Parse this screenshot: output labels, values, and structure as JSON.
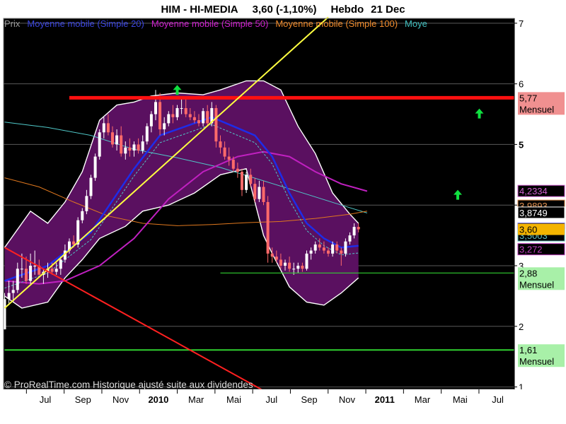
{
  "header": {
    "ticker": "HIM - HI-MEDIA",
    "quote": "3,60 (-1,10%)",
    "period": "Hebdo",
    "date": "21 Dec"
  },
  "legend": [
    {
      "label": "Prix",
      "color": "#9a9a9a"
    },
    {
      "label": "Moyenne mobile (Simple 20)",
      "color": "#3a45e0"
    },
    {
      "label": "Moyenne mobile (Simple 50)",
      "color": "#d020d0"
    },
    {
      "label": "Moyenne mobile (Simple 100)",
      "color": "#f08a2a"
    },
    {
      "label": "Moye",
      "color": "#3fc0c0"
    }
  ],
  "copyright": "© ProRealTime.com Historique ajusté suite aux dividendes",
  "colors": {
    "background": "#000000",
    "candle_up": "#ffffff",
    "candle_down": "#ff6a6a",
    "bollinger_fill": "#5a1060",
    "bollinger_line": "#ffffff",
    "sma20": "#1e2ce8",
    "sma50": "#c020c0",
    "sma100": "#e0781e",
    "sma200": "#50c8c8",
    "resistance": "#ff1010",
    "support": "#30d030",
    "trend_up": "#ffff40",
    "trend_down": "#ff2020",
    "arrow": "#10e040"
  },
  "chart_data": {
    "type": "candlestick",
    "y_axis": {
      "ylim": [
        0.96,
        7.08
      ],
      "ticks": [
        "1",
        "2",
        "3",
        "4",
        "5",
        "6",
        "7"
      ],
      "bold_ticks": [
        "5"
      ]
    },
    "x_axis": {
      "ticks": [
        "Jul",
        "Sep",
        "Nov",
        "2010",
        "Mar",
        "Mai",
        "Jul",
        "Sep",
        "Nov",
        "2011",
        "Mar",
        "Mai",
        "Jul"
      ],
      "bold_ticks": [
        "2010",
        "2011"
      ]
    },
    "ohlc": [
      [
        1.95,
        2.55,
        1.95,
        2.45
      ],
      [
        2.45,
        2.75,
        2.35,
        2.55
      ],
      [
        2.55,
        2.75,
        2.4,
        2.6
      ],
      [
        2.6,
        3.05,
        2.55,
        2.95
      ],
      [
        2.95,
        3.2,
        2.8,
        2.95
      ],
      [
        2.95,
        3.15,
        2.7,
        2.75
      ],
      [
        2.75,
        3.2,
        2.7,
        3.0
      ],
      [
        3.0,
        3.25,
        2.85,
        3.0
      ],
      [
        3.0,
        3.1,
        2.85,
        2.85
      ],
      [
        2.85,
        2.95,
        2.7,
        2.9
      ],
      [
        2.9,
        3.05,
        2.8,
        2.95
      ],
      [
        2.95,
        3.05,
        2.85,
        2.9
      ],
      [
        2.9,
        3.05,
        2.85,
        2.95
      ],
      [
        2.95,
        3.15,
        2.85,
        3.1
      ],
      [
        3.1,
        3.35,
        3.05,
        3.25
      ],
      [
        3.25,
        3.45,
        3.2,
        3.4
      ],
      [
        3.4,
        3.5,
        3.3,
        3.35
      ],
      [
        3.35,
        3.8,
        3.3,
        3.75
      ],
      [
        3.75,
        3.95,
        3.7,
        3.9
      ],
      [
        3.9,
        4.25,
        3.85,
        4.15
      ],
      [
        4.15,
        4.5,
        4.1,
        4.45
      ],
      [
        4.45,
        4.85,
        4.4,
        4.8
      ],
      [
        4.8,
        5.25,
        4.75,
        5.2
      ],
      [
        5.2,
        5.45,
        5.1,
        5.35
      ],
      [
        5.35,
        5.5,
        5.15,
        5.2
      ],
      [
        5.2,
        5.3,
        4.95,
        5.0
      ],
      [
        5.0,
        5.25,
        4.9,
        5.15
      ],
      [
        5.15,
        5.3,
        4.8,
        4.85
      ],
      [
        4.85,
        5.05,
        4.75,
        4.95
      ],
      [
        4.95,
        5.1,
        4.8,
        4.9
      ],
      [
        4.9,
        5.05,
        4.8,
        5.0
      ],
      [
        5.0,
        5.1,
        4.85,
        4.9
      ],
      [
        4.9,
        5.15,
        4.85,
        5.05
      ],
      [
        5.05,
        5.35,
        5.0,
        5.3
      ],
      [
        5.3,
        5.55,
        5.2,
        5.5
      ],
      [
        5.5,
        5.9,
        5.4,
        5.7
      ],
      [
        5.7,
        5.85,
        5.15,
        5.25
      ],
      [
        5.25,
        5.45,
        5.15,
        5.35
      ],
      [
        5.35,
        5.55,
        5.3,
        5.5
      ],
      [
        5.5,
        5.65,
        5.35,
        5.45
      ],
      [
        5.45,
        5.65,
        5.4,
        5.6
      ],
      [
        5.6,
        5.75,
        5.5,
        5.6
      ],
      [
        5.6,
        5.75,
        5.45,
        5.5
      ],
      [
        5.5,
        5.6,
        5.4,
        5.45
      ],
      [
        5.45,
        5.55,
        5.35,
        5.4
      ],
      [
        5.4,
        5.5,
        5.3,
        5.35
      ],
      [
        5.35,
        5.6,
        5.3,
        5.55
      ],
      [
        5.55,
        5.65,
        5.3,
        5.35
      ],
      [
        5.35,
        5.7,
        5.3,
        5.6
      ],
      [
        5.6,
        5.65,
        4.95,
        5.05
      ],
      [
        5.05,
        5.15,
        4.85,
        4.95
      ],
      [
        4.95,
        5.05,
        4.75,
        4.8
      ],
      [
        4.8,
        4.95,
        4.65,
        4.75
      ],
      [
        4.75,
        4.8,
        4.55,
        4.6
      ],
      [
        4.6,
        4.7,
        4.45,
        4.55
      ],
      [
        4.55,
        4.6,
        4.15,
        4.25
      ],
      [
        4.25,
        4.55,
        4.2,
        4.5
      ],
      [
        4.5,
        4.6,
        4.3,
        4.35
      ],
      [
        4.35,
        4.45,
        4.05,
        4.1
      ],
      [
        4.1,
        4.4,
        4.05,
        4.3
      ],
      [
        4.3,
        4.4,
        4.0,
        4.05
      ],
      [
        4.05,
        4.15,
        3.05,
        3.2
      ],
      [
        3.2,
        3.3,
        3.05,
        3.15
      ],
      [
        3.15,
        3.25,
        3.05,
        3.1
      ],
      [
        3.1,
        3.2,
        2.95,
        3.0
      ],
      [
        3.0,
        3.1,
        2.92,
        3.05
      ],
      [
        3.05,
        3.15,
        2.9,
        2.95
      ],
      [
        2.95,
        3.05,
        2.85,
        2.95
      ],
      [
        2.95,
        3.05,
        2.88,
        3.0
      ],
      [
        3.0,
        3.05,
        2.9,
        2.95
      ],
      [
        2.95,
        3.25,
        2.92,
        3.2
      ],
      [
        3.2,
        3.3,
        3.1,
        3.25
      ],
      [
        3.25,
        3.4,
        3.2,
        3.35
      ],
      [
        3.35,
        3.45,
        3.25,
        3.3
      ],
      [
        3.3,
        3.4,
        3.2,
        3.25
      ],
      [
        3.25,
        3.3,
        3.15,
        3.2
      ],
      [
        3.2,
        3.4,
        3.15,
        3.35
      ],
      [
        3.35,
        3.4,
        3.2,
        3.25
      ],
      [
        3.25,
        3.3,
        3.0,
        3.2
      ],
      [
        3.2,
        3.45,
        3.15,
        3.4
      ],
      [
        3.4,
        3.55,
        3.35,
        3.5
      ],
      [
        3.5,
        3.7,
        3.45,
        3.64
      ],
      [
        3.64,
        3.7,
        3.55,
        3.6
      ]
    ],
    "sma20": [
      [
        0,
        2.75
      ],
      [
        10,
        3.0
      ],
      [
        20,
        3.55
      ],
      [
        30,
        4.6
      ],
      [
        36,
        5.15
      ],
      [
        42,
        5.3
      ],
      [
        48,
        5.45
      ],
      [
        53,
        5.3
      ],
      [
        58,
        5.15
      ],
      [
        62,
        4.8
      ],
      [
        66,
        4.2
      ],
      [
        70,
        3.7
      ],
      [
        74,
        3.45
      ],
      [
        78,
        3.3
      ],
      [
        82,
        3.33
      ]
    ],
    "sma50": [
      [
        0,
        2.75
      ],
      [
        8,
        2.7
      ],
      [
        14,
        2.75
      ],
      [
        22,
        3.0
      ],
      [
        30,
        3.45
      ],
      [
        38,
        4.1
      ],
      [
        46,
        4.55
      ],
      [
        54,
        4.8
      ],
      [
        60,
        4.88
      ],
      [
        66,
        4.8
      ],
      [
        72,
        4.55
      ],
      [
        78,
        4.35
      ],
      [
        84,
        4.23
      ]
    ],
    "sma100": [
      [
        0,
        4.45
      ],
      [
        8,
        4.3
      ],
      [
        16,
        4.05
      ],
      [
        24,
        3.82
      ],
      [
        32,
        3.7
      ],
      [
        40,
        3.66
      ],
      [
        48,
        3.68
      ],
      [
        56,
        3.71
      ],
      [
        64,
        3.73
      ],
      [
        72,
        3.78
      ],
      [
        80,
        3.85
      ],
      [
        84,
        3.9
      ]
    ],
    "sma200": [
      [
        0,
        5.37
      ],
      [
        10,
        5.28
      ],
      [
        20,
        5.15
      ],
      [
        30,
        4.92
      ],
      [
        40,
        4.78
      ],
      [
        50,
        4.62
      ],
      [
        60,
        4.4
      ],
      [
        70,
        4.18
      ],
      [
        78,
        4.0
      ],
      [
        84,
        3.87
      ]
    ],
    "boll_upper": [
      [
        0,
        3.3
      ],
      [
        6,
        3.9
      ],
      [
        10,
        3.7
      ],
      [
        14,
        4.05
      ],
      [
        18,
        4.55
      ],
      [
        22,
        5.4
      ],
      [
        26,
        5.65
      ],
      [
        30,
        5.7
      ],
      [
        34,
        5.8
      ],
      [
        40,
        5.85
      ],
      [
        46,
        5.82
      ],
      [
        50,
        5.9
      ],
      [
        56,
        6.05
      ],
      [
        60,
        6.05
      ],
      [
        64,
        5.9
      ],
      [
        68,
        5.3
      ],
      [
        72,
        4.85
      ],
      [
        76,
        4.2
      ],
      [
        80,
        3.85
      ],
      [
        82,
        3.7
      ]
    ],
    "boll_lower": [
      [
        0,
        2.5
      ],
      [
        4,
        2.3
      ],
      [
        10,
        2.4
      ],
      [
        14,
        2.8
      ],
      [
        18,
        3.1
      ],
      [
        22,
        3.45
      ],
      [
        28,
        3.65
      ],
      [
        32,
        3.9
      ],
      [
        38,
        4.0
      ],
      [
        44,
        4.2
      ],
      [
        50,
        4.5
      ],
      [
        56,
        4.6
      ],
      [
        60,
        3.5
      ],
      [
        62,
        3.2
      ],
      [
        66,
        2.65
      ],
      [
        70,
        2.4
      ],
      [
        74,
        2.35
      ],
      [
        78,
        2.55
      ],
      [
        82,
        2.8
      ]
    ],
    "resistance": {
      "value": 5.77,
      "x_start": 15,
      "label": "Mensuel"
    },
    "supports": [
      {
        "value": 2.88,
        "x_start": 50,
        "label": "Mensuel"
      },
      {
        "value": 1.61,
        "x_start": 0,
        "label": "Mensuel"
      }
    ],
    "trend_up": {
      "from": [
        0,
        2.3
      ],
      "to": [
        75,
        7.1
      ]
    },
    "trend_down": {
      "from": [
        0,
        3.3
      ],
      "to": [
        61,
        0.9
      ]
    },
    "arrows": [
      [
        40,
        5.9
      ],
      [
        110,
        5.51
      ],
      [
        105,
        4.17
      ]
    ],
    "axis_tags": [
      {
        "value": 5.77,
        "text": "5,77",
        "bg": "#f09090",
        "fg": "#000000",
        "sub": "Mensuel"
      },
      {
        "value": 4.2334,
        "text": "4,2334",
        "bg": "#000000",
        "fg": "#d060d0",
        "border": "#d060d0"
      },
      {
        "value": 3.9893,
        "text": "3,9893",
        "bg": "#000000",
        "fg": "#e09050",
        "border": "#e09050"
      },
      {
        "value": 3.8749,
        "text": "3,8749",
        "bg": "#000000",
        "fg": "#ffffff",
        "border": "#ffffff"
      },
      {
        "value": 3.6112,
        "text": "3,6112",
        "bg": "#000000",
        "fg": "#6e6ef0",
        "border": "#6e6ef0"
      },
      {
        "value": 3.5003,
        "text": "3,5003",
        "bg": "#000000",
        "fg": "#60c0c0",
        "border": "#60c0c0"
      },
      {
        "value": 3.6,
        "text": "3,60",
        "bg": "#f4b400",
        "fg": "#000000"
      },
      {
        "value": 3.272,
        "text": "3,272",
        "bg": "#000000",
        "fg": "#c040c0",
        "border": "#c040c0"
      },
      {
        "value": 2.88,
        "text": "2,88",
        "bg": "#a8f0a8",
        "fg": "#000000",
        "sub": "Mensuel"
      },
      {
        "value": 1.61,
        "text": "1,61",
        "bg": "#a8f0a8",
        "fg": "#000000",
        "sub": "Mensuel"
      }
    ]
  }
}
